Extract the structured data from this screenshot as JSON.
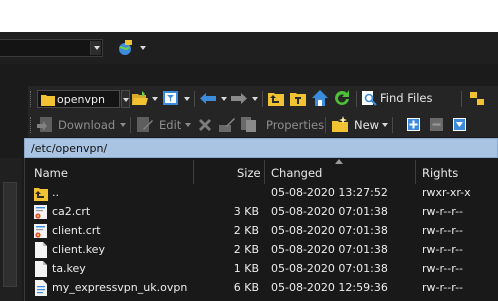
{
  "session_bar": {
    "combo_value": ""
  },
  "toolbar_nav": {
    "directory": "openvpn",
    "find_files_label": "Find Files"
  },
  "toolbar_actions": {
    "download_label": "Download",
    "edit_label": "Edit",
    "properties_label": "Properties",
    "new_label": "New"
  },
  "path": "/etc/openvpn/",
  "columns": {
    "name": "Name",
    "size": "Size",
    "changed": "Changed",
    "rights": "Rights"
  },
  "files": [
    {
      "name": "..",
      "size": "",
      "changed": "05-08-2020 13:27:52",
      "rights": "rwxr-xr-x",
      "icon": "parent-folder-icon"
    },
    {
      "name": "ca2.crt",
      "size": "3 KB",
      "changed": "05-08-2020 07:01:38",
      "rights": "rw-r--r--",
      "icon": "certificate-icon"
    },
    {
      "name": "client.crt",
      "size": "2 KB",
      "changed": "05-08-2020 07:01:38",
      "rights": "rw-r--r--",
      "icon": "certificate-icon"
    },
    {
      "name": "client.key",
      "size": "2 KB",
      "changed": "05-08-2020 07:01:38",
      "rights": "rw-r--r--",
      "icon": "file-icon"
    },
    {
      "name": "ta.key",
      "size": "1 KB",
      "changed": "05-08-2020 07:01:38",
      "rights": "rw-r--r--",
      "icon": "file-icon"
    },
    {
      "name": "my_expressvpn_uk.ovpn",
      "size": "6 KB",
      "changed": "05-08-2020 12:59:36",
      "rights": "rw-r--r--",
      "icon": "document-icon"
    }
  ],
  "colors": {
    "path_bar": "#a9c4e2",
    "accent_blue": "#3d8bdc",
    "folder_yellow": "#f1c232"
  }
}
